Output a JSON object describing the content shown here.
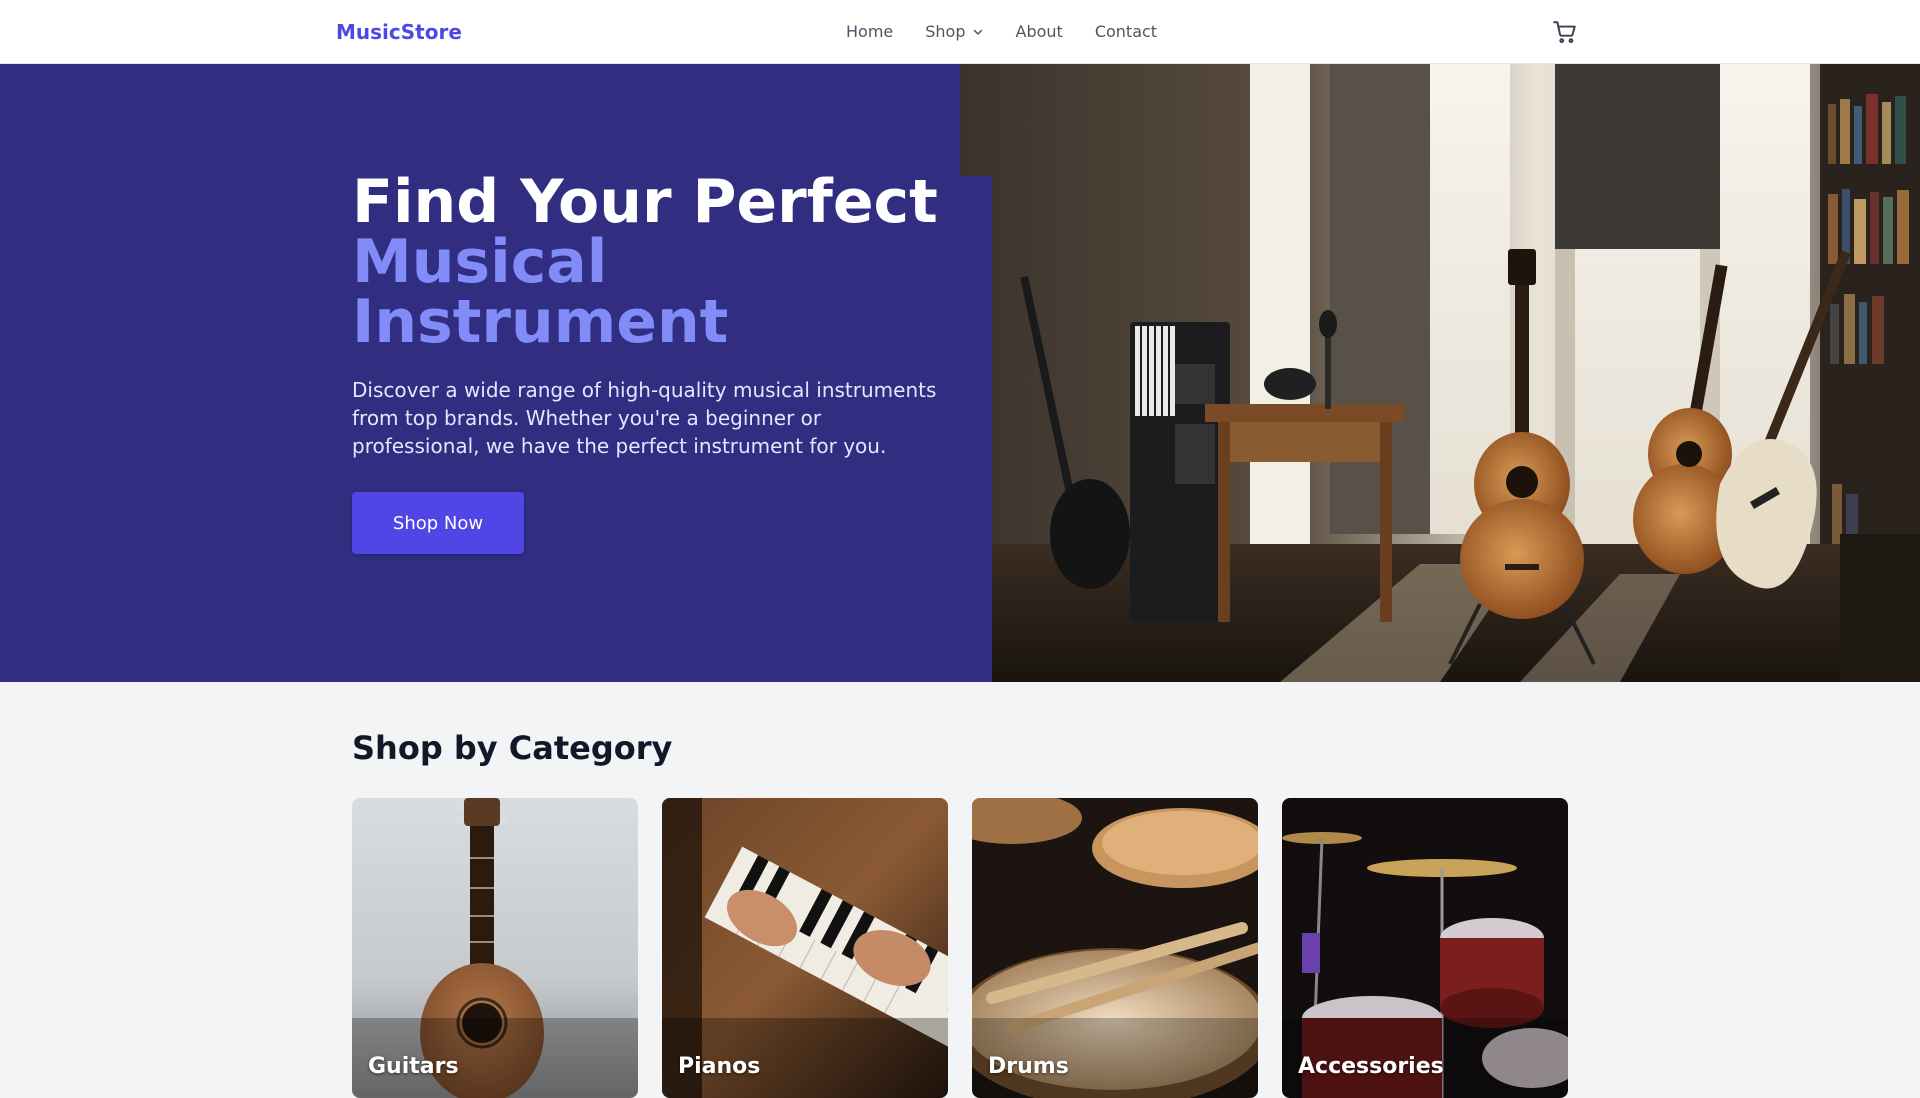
{
  "brand": {
    "name": "MusicStore",
    "color": "#4f46e5"
  },
  "nav": {
    "items": [
      {
        "label": "Home"
      },
      {
        "label": "Shop",
        "has_dropdown": true,
        "icon": "chevron-down-icon"
      },
      {
        "label": "About"
      },
      {
        "label": "Contact"
      }
    ],
    "cart_icon": "cart-icon"
  },
  "hero": {
    "title_line1": "Find Your Perfect",
    "title_accent": "Musical Instrument",
    "description": "Discover a wide range of high-quality musical instruments from top brands. Whether you're a beginner or professional, we have the perfect instrument for you.",
    "cta_label": "Shop Now",
    "background_color": "#312e81",
    "accent_color": "#818cf8",
    "image": "music-studio-photo"
  },
  "categories": {
    "heading": "Shop by Category",
    "items": [
      {
        "label": "Guitars",
        "image": "ukulele-photo"
      },
      {
        "label": "Pianos",
        "image": "piano-keys-photo"
      },
      {
        "label": "Drums",
        "image": "drum-sticks-photo"
      },
      {
        "label": "Accessories",
        "image": "drum-kit-photo"
      }
    ]
  }
}
